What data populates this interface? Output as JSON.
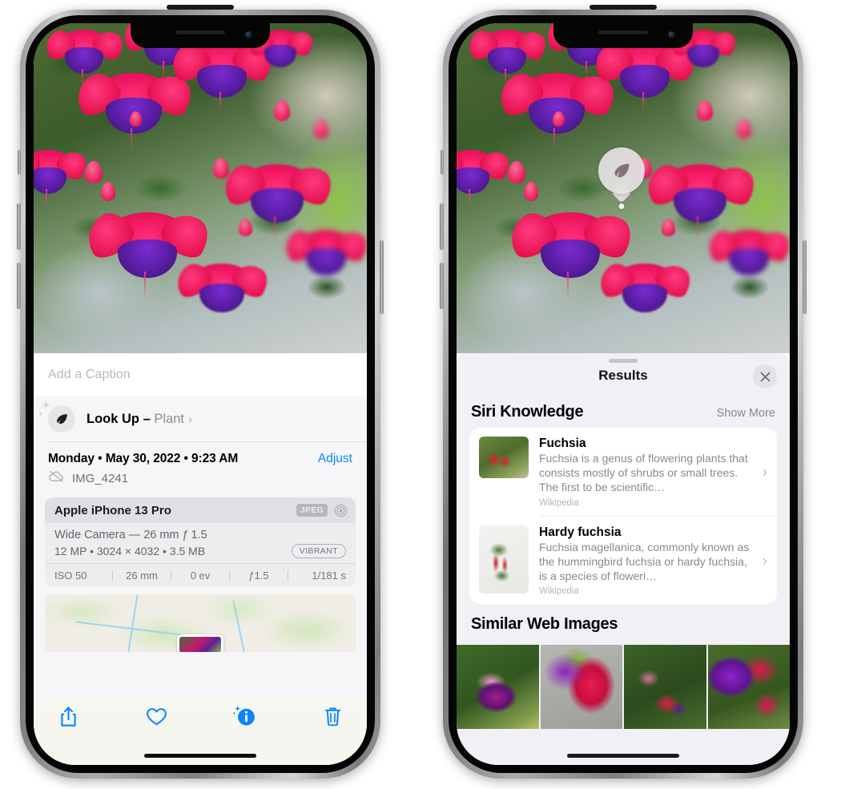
{
  "left_phone": {
    "caption": {
      "placeholder": "Add a Caption",
      "value": ""
    },
    "lookup_row": {
      "icon": "leaf-icon",
      "sparkle_icon": "sparkles-icon",
      "label": "Look Up –",
      "subject": "Plant",
      "chevron": "›"
    },
    "date_row": {
      "date_text": "Monday • May 30, 2022 • 9:23 AM",
      "adjust_label": "Adjust"
    },
    "file_row": {
      "icon": "cloud-slash-icon",
      "filename": "IMG_4241"
    },
    "exif": {
      "device": "Apple iPhone 13 Pro",
      "format_badge": "JPEG",
      "hdr_icon": "hdr-circle-icon",
      "lens_line": "Wide Camera — 26 mm ƒ 1.5",
      "size_line": "12 MP • 3024 × 4032 • 3.5 MB",
      "style_badge": "VIBRANT",
      "stats": [
        "ISO 50",
        "26 mm",
        "0 ev",
        "ƒ1.5",
        "1/181 s"
      ]
    },
    "map": {
      "thumbnail": "photo-location-thumbnail"
    },
    "toolbar": [
      {
        "name": "share-button",
        "icon": "share-icon"
      },
      {
        "name": "favorite-button",
        "icon": "heart-icon"
      },
      {
        "name": "info-button",
        "icon": "info-sparkle-icon"
      },
      {
        "name": "delete-button",
        "icon": "trash-icon"
      }
    ],
    "accent_color": "#0a84ff"
  },
  "right_phone": {
    "lookup_badge": {
      "icon": "leaf-icon"
    },
    "sheet": {
      "title": "Results",
      "close_icon": "close-icon",
      "grabber": "sheet-grabber"
    },
    "siri_knowledge": {
      "title": "Siri Knowledge",
      "action": "Show More",
      "items": [
        {
          "title": "Fuchsia",
          "description": "Fuchsia is a genus of flowering plants that consists mostly of shrubs or small trees. The first to be scientific…",
          "source": "Wikipedia",
          "thumbnail": "fuchsia-flower-thumbnail"
        },
        {
          "title": "Hardy fuchsia",
          "description": "Fuchsia magellanica, commonly known as the hummingbird fuchsia or hardy fuchsia, is a species of floweri…",
          "source": "Wikipedia",
          "thumbnail": "hardy-fuchsia-thumbnail"
        }
      ]
    },
    "similar_web_images": {
      "title": "Similar Web Images",
      "images": [
        "pink-purple-fuchsia-leaves",
        "red-magenta-fuchsia-closeup",
        "fuchsia-bush-buds",
        "purple-red-fuchsia-cluster"
      ]
    }
  }
}
